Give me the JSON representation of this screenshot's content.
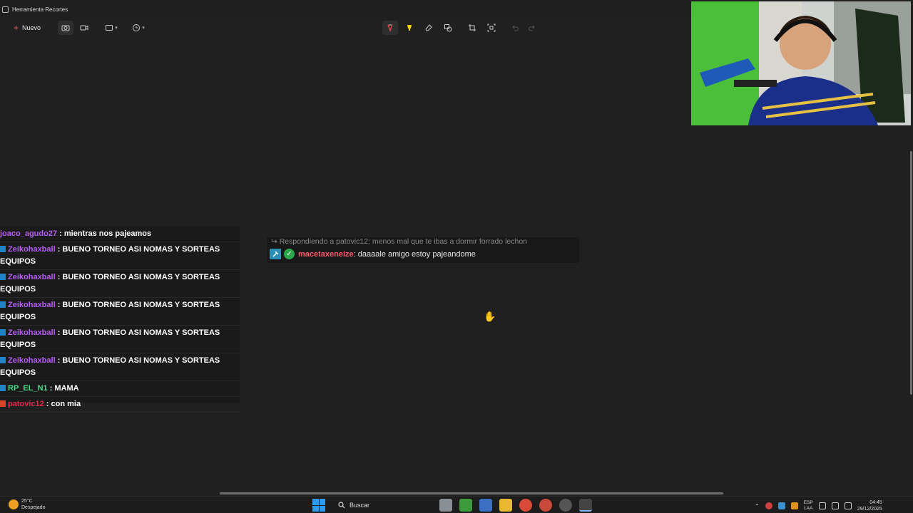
{
  "window": {
    "title": "Herramienta Recortes"
  },
  "toolbar": {
    "new_label": "Nuevo"
  },
  "chat": [
    {
      "user": "joaco_agudo27",
      "color": "#b85cf5",
      "badge": "",
      "text": ": mientras nos pajeamos"
    },
    {
      "user": "Zeikohaxball",
      "color": "#b85cf5",
      "badge": "blue",
      "text": ": BUENO TORNEO ASI NOMAS Y SORTEAS",
      "cont": "EQUIPOS"
    },
    {
      "user": "Zeikohaxball",
      "color": "#b85cf5",
      "badge": "blue",
      "text": ": BUENO TORNEO ASI NOMAS Y SORTEAS",
      "cont": "EQUIPOS"
    },
    {
      "user": "Zeikohaxball",
      "color": "#b85cf5",
      "badge": "blue",
      "text": ": BUENO TORNEO ASI NOMAS Y SORTEAS",
      "cont": "EQUIPOS"
    },
    {
      "user": "Zeikohaxball",
      "color": "#b85cf5",
      "badge": "blue",
      "text": ": BUENO TORNEO ASI NOMAS Y SORTEAS",
      "cont": "EQUIPOS"
    },
    {
      "user": "Zeikohaxball",
      "color": "#b85cf5",
      "badge": "blue",
      "text": ": BUENO TORNEO ASI NOMAS Y SORTEAS",
      "cont": "EQUIPOS"
    },
    {
      "user": "RP_EL_N1",
      "color": "#4fd98a",
      "badge": "blue",
      "text": ": MAMA"
    },
    {
      "user": "patovic12",
      "color": "#e0284a",
      "badge": "red",
      "text": ": con mia"
    }
  ],
  "reply": {
    "ref": "Respondiendo a patovic12: menos mal que te ibas a dormir forrado lechon",
    "user": "macetaxeneize",
    "text": ": daaaale amigo estoy pajeandome"
  },
  "taskbar": {
    "temp": "25°C",
    "weather": "Despejado",
    "search_label": "Buscar",
    "lang_top": "ESP",
    "lang_bottom": "LAA",
    "time": "04:45",
    "date": "29/12/2025"
  }
}
